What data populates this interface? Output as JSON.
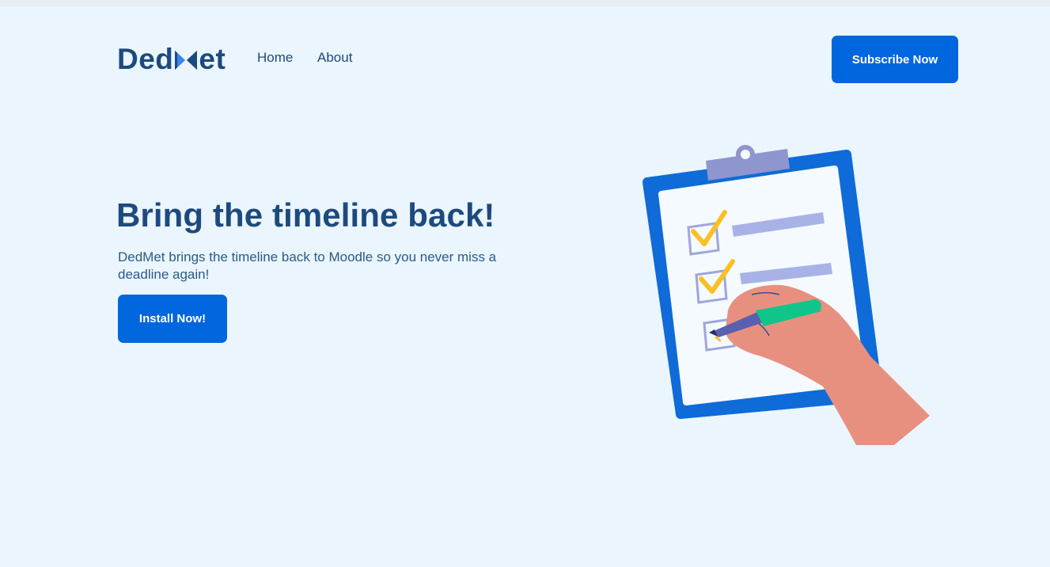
{
  "nav": {
    "logo_text_before": "Ded",
    "logo_text_after": "et",
    "logo_mark_icon": "m-bowtie-logo-mark",
    "links": [
      {
        "label": "Home"
      },
      {
        "label": "About"
      }
    ],
    "subscribe_label": "Subscribe Now"
  },
  "hero": {
    "title": "Bring the timeline back!",
    "description": "DedMet brings the timeline back to Moodle so you never miss a deadline again!",
    "install_label": "Install Now!",
    "illustration_icon": "clipboard-checklist-illustration"
  },
  "colors": {
    "background": "#eaf5fd",
    "primary": "#0066dd",
    "heading": "#1d4a7e",
    "check": "#fbbf24",
    "pen": "#10c58a",
    "skin": "#e89080"
  }
}
